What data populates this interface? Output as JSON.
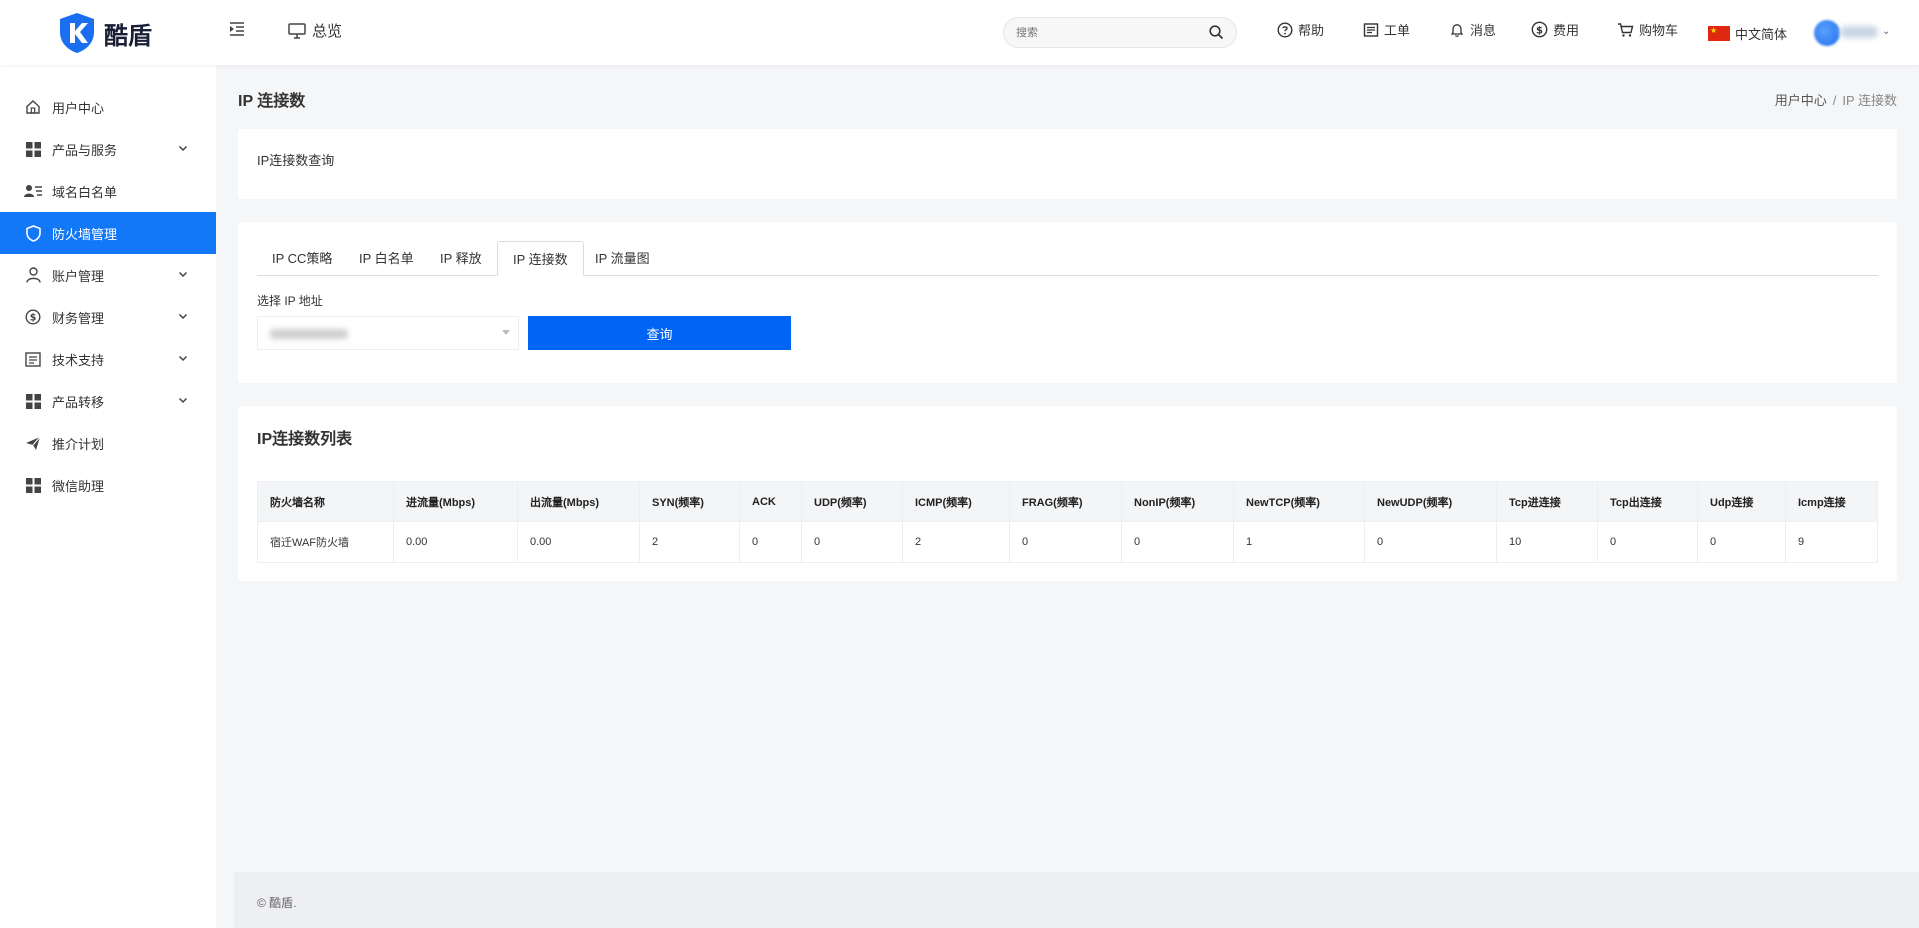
{
  "header": {
    "logo_text": "酷盾",
    "overview_label": "总览",
    "search_placeholder": "搜索",
    "nav": {
      "help": "帮助",
      "ticket": "工单",
      "message": "消息",
      "fee": "费用",
      "cart": "购物车",
      "language": "中文简体"
    }
  },
  "sidebar": {
    "items": [
      {
        "label": "用户中心",
        "icon": "home-icon",
        "has_submenu": false
      },
      {
        "label": "产品与服务",
        "icon": "grid-icon",
        "has_submenu": true
      },
      {
        "label": "域名白名单",
        "icon": "user-list-icon",
        "has_submenu": false
      },
      {
        "label": "防火墙管理",
        "icon": "shield-icon",
        "has_submenu": false,
        "active": true
      },
      {
        "label": "账户管理",
        "icon": "user-icon",
        "has_submenu": true
      },
      {
        "label": "财务管理",
        "icon": "dollar-icon",
        "has_submenu": true
      },
      {
        "label": "技术支持",
        "icon": "document-icon",
        "has_submenu": true
      },
      {
        "label": "产品转移",
        "icon": "grid-icon",
        "has_submenu": true
      },
      {
        "label": "推介计划",
        "icon": "send-icon",
        "has_submenu": false
      },
      {
        "label": "微信助理",
        "icon": "grid-icon",
        "has_submenu": false
      }
    ]
  },
  "page": {
    "title": "IP 连接数",
    "breadcrumb": {
      "home": "用户中心",
      "separator": "/",
      "current": "IP 连接数"
    }
  },
  "query_card": {
    "label": "IP连接数查询"
  },
  "tabs": [
    {
      "label": "IP CC策略"
    },
    {
      "label": "IP 白名单"
    },
    {
      "label": "IP 释放"
    },
    {
      "label": "IP 连接数",
      "active": true
    },
    {
      "label": "IP 流量图"
    }
  ],
  "ip_form": {
    "label": "选择 IP 地址",
    "query_button": "查询"
  },
  "list": {
    "title": "IP连接数列表",
    "columns": [
      "防火墙名称",
      "进流量(Mbps)",
      "出流量(Mbps)",
      "SYN(频率)",
      "ACK",
      "UDP(频率)",
      "ICMP(频率)",
      "FRAG(频率)",
      "NonIP(频率)",
      "NewTCP(频率)",
      "NewUDP(频率)",
      "Tcp进连接",
      "Tcp出连接",
      "Udp连接",
      "Icmp连接"
    ],
    "rows": [
      [
        "宿迁WAF防火墙",
        "0.00",
        "0.00",
        "2",
        "0",
        "0",
        "2",
        "0",
        "0",
        "1",
        "0",
        "10",
        "0",
        "0",
        "9"
      ]
    ]
  },
  "footer": {
    "text": "© 酷盾."
  },
  "colors": {
    "accent": "#1278f8",
    "button": "#0065f5"
  }
}
